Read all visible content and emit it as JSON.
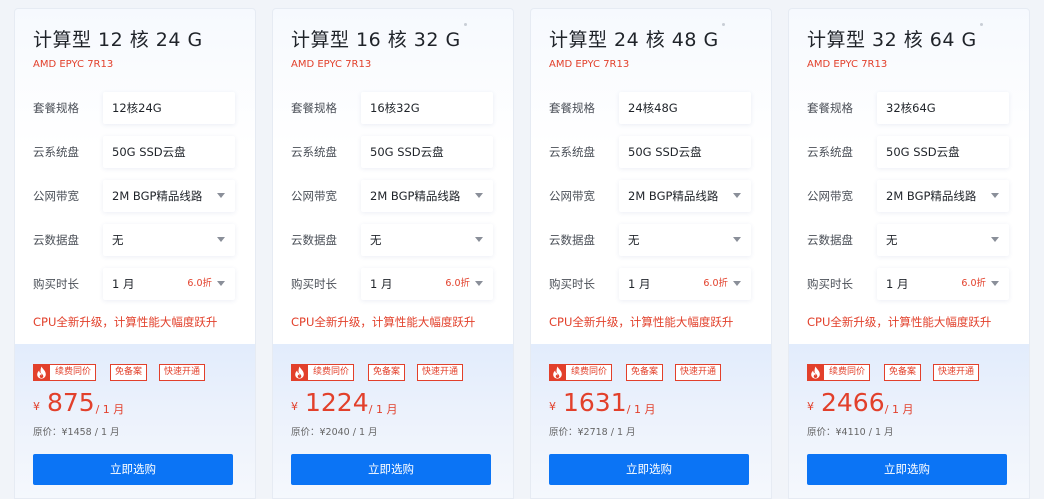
{
  "labels": {
    "spec": "套餐规格",
    "system_disk": "云系统盘",
    "bandwidth": "公网带宽",
    "data_disk": "云数据盘",
    "duration": "购买时长",
    "orig_prefix": "原价：",
    "buy_button": "立即选购",
    "currency": "¥"
  },
  "accent_color": "#e2402b",
  "button_color": "#0b74f5",
  "cards": [
    {
      "title": "计算型 12 核 24 G",
      "cpu": "AMD EPYC 7R13",
      "spec": "12核24G",
      "system_disk": "50G SSD云盘",
      "bandwidth": "2M BGP精品线路",
      "data_disk": "无",
      "duration": "1 月",
      "discount": "6.0折",
      "promo": "CPU全新升级，计算性能大幅度跃升",
      "tags": [
        "续费同价",
        "免备案",
        "快速开通"
      ],
      "price": "875",
      "period": "/ 1 月",
      "orig_price": "原价：¥1458 / 1 月"
    },
    {
      "title": "计算型 16 核 32 G",
      "cpu": "AMD EPYC 7R13",
      "spec": "16核32G",
      "system_disk": "50G SSD云盘",
      "bandwidth": "2M BGP精品线路",
      "data_disk": "无",
      "duration": "1 月",
      "discount": "6.0折",
      "promo": "CPU全新升级，计算性能大幅度跃升",
      "tags": [
        "续费同价",
        "免备案",
        "快速开通"
      ],
      "price": "1224",
      "period": "/ 1 月",
      "orig_price": "原价：¥2040 / 1 月"
    },
    {
      "title": "计算型 24 核 48 G",
      "cpu": "AMD EPYC 7R13",
      "spec": "24核48G",
      "system_disk": "50G SSD云盘",
      "bandwidth": "2M BGP精品线路",
      "data_disk": "无",
      "duration": "1 月",
      "discount": "6.0折",
      "promo": "CPU全新升级，计算性能大幅度跃升",
      "tags": [
        "续费同价",
        "免备案",
        "快速开通"
      ],
      "price": "1631",
      "period": "/ 1 月",
      "orig_price": "原价：¥2718 / 1 月"
    },
    {
      "title": "计算型 32 核 64 G",
      "cpu": "AMD EPYC 7R13",
      "spec": "32核64G",
      "system_disk": "50G SSD云盘",
      "bandwidth": "2M BGP精品线路",
      "data_disk": "无",
      "duration": "1 月",
      "discount": "6.0折",
      "promo": "CPU全新升级，计算性能大幅度跃升",
      "tags": [
        "续费同价",
        "免备案",
        "快速开通"
      ],
      "price": "2466",
      "period": "/ 1 月",
      "orig_price": "原价：¥4110 / 1 月"
    }
  ]
}
